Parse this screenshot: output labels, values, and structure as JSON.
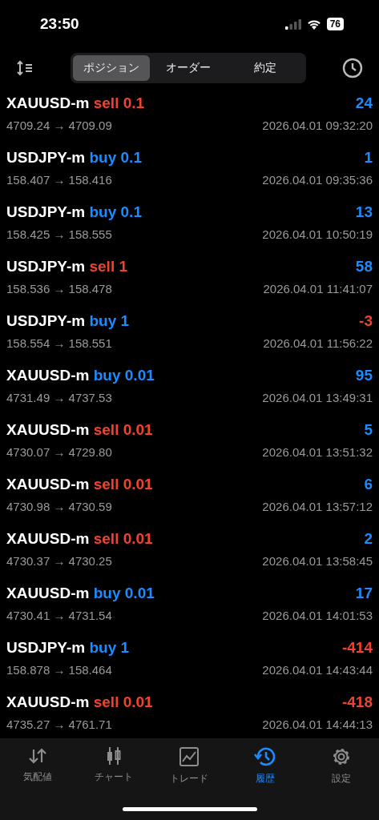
{
  "status_bar": {
    "time": "23:50",
    "battery": "76"
  },
  "segments": [
    {
      "label": "ポジション",
      "selected": true
    },
    {
      "label": "オーダー",
      "selected": false
    },
    {
      "label": "約定",
      "selected": false
    }
  ],
  "deals": [
    {
      "symbol": "XAUUSD-m",
      "kind": "sell",
      "side": "sell",
      "lots": "0.1",
      "profit": "24",
      "loss": false,
      "prices": "4709.24 → 4709.09",
      "time": "2026.04.01 09:32:20"
    },
    {
      "symbol": "USDJPY-m",
      "kind": "buy",
      "side": "buy",
      "lots": "0.1",
      "profit": "1",
      "loss": false,
      "prices": "158.407 → 158.416",
      "time": "2026.04.01 09:35:36"
    },
    {
      "symbol": "USDJPY-m",
      "kind": "buy",
      "side": "buy",
      "lots": "0.1",
      "profit": "13",
      "loss": false,
      "prices": "158.425 → 158.555",
      "time": "2026.04.01 10:50:19"
    },
    {
      "symbol": "USDJPY-m",
      "kind": "sell",
      "side": "sell",
      "lots": "1",
      "profit": "58",
      "loss": false,
      "prices": "158.536 → 158.478",
      "time": "2026.04.01 11:41:07"
    },
    {
      "symbol": "USDJPY-m",
      "kind": "buy",
      "side": "buy",
      "lots": "1",
      "profit": "-3",
      "loss": true,
      "prices": "158.554 → 158.551",
      "time": "2026.04.01 11:56:22"
    },
    {
      "symbol": "XAUUSD-m",
      "kind": "buy",
      "side": "buy",
      "lots": "0.01",
      "profit": "95",
      "loss": false,
      "prices": "4731.49 → 4737.53",
      "time": "2026.04.01 13:49:31"
    },
    {
      "symbol": "XAUUSD-m",
      "kind": "sell",
      "side": "sell",
      "lots": "0.01",
      "profit": "5",
      "loss": false,
      "prices": "4730.07 → 4729.80",
      "time": "2026.04.01 13:51:32"
    },
    {
      "symbol": "XAUUSD-m",
      "kind": "sell",
      "side": "sell",
      "lots": "0.01",
      "profit": "6",
      "loss": false,
      "prices": "4730.98 → 4730.59",
      "time": "2026.04.01 13:57:12"
    },
    {
      "symbol": "XAUUSD-m",
      "kind": "sell",
      "side": "sell",
      "lots": "0.01",
      "profit": "2",
      "loss": false,
      "prices": "4730.37 → 4730.25",
      "time": "2026.04.01 13:58:45"
    },
    {
      "symbol": "XAUUSD-m",
      "kind": "buy",
      "side": "buy",
      "lots": "0.01",
      "profit": "17",
      "loss": false,
      "prices": "4730.41 → 4731.54",
      "time": "2026.04.01 14:01:53"
    },
    {
      "symbol": "USDJPY-m",
      "kind": "buy",
      "side": "buy",
      "lots": "1",
      "profit": "-414",
      "loss": true,
      "prices": "158.878 → 158.464",
      "time": "2026.04.01 14:43:44"
    },
    {
      "symbol": "XAUUSD-m",
      "kind": "sell",
      "side": "sell",
      "lots": "0.01",
      "profit": "-418",
      "loss": true,
      "prices": "4735.27 → 4761.71",
      "time": "2026.04.01 14:44:13"
    }
  ],
  "tab_bar": [
    {
      "label": "気配値",
      "selected": false
    },
    {
      "label": "チャート",
      "selected": false
    },
    {
      "label": "トレード",
      "selected": false
    },
    {
      "label": "履歴",
      "selected": true
    },
    {
      "label": "設定",
      "selected": false
    }
  ]
}
